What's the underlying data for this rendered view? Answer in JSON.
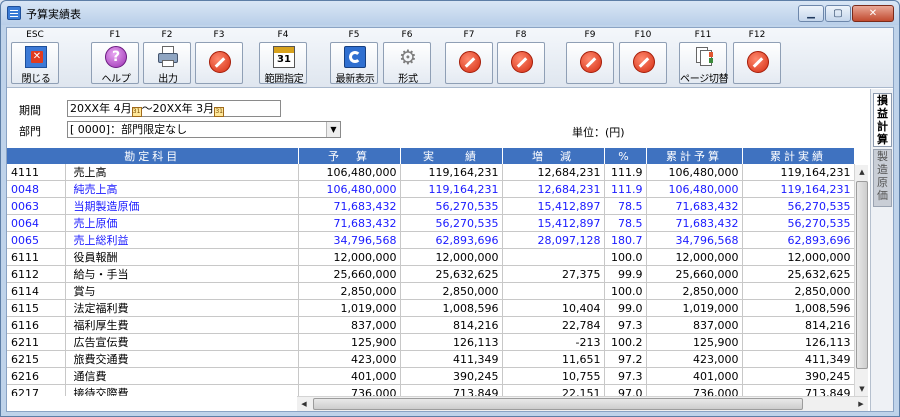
{
  "window": {
    "title": "予算実績表"
  },
  "toolbar": {
    "keys": [
      {
        "key": "ESC",
        "label": "閉じる",
        "icon": "close-window-icon"
      },
      {
        "key": "F1",
        "label": "ヘルプ",
        "icon": "help-icon"
      },
      {
        "key": "F2",
        "label": "出力",
        "icon": "print-icon"
      },
      {
        "key": "F3",
        "label": "",
        "icon": "disabled-icon"
      },
      {
        "key": "F4",
        "label": "範囲指定",
        "icon": "calendar-icon"
      },
      {
        "key": "F5",
        "label": "最新表示",
        "icon": "refresh-icon"
      },
      {
        "key": "F6",
        "label": "形式",
        "icon": "gear-icon"
      },
      {
        "key": "F7",
        "label": "",
        "icon": "disabled-icon"
      },
      {
        "key": "F8",
        "label": "",
        "icon": "disabled-icon"
      },
      {
        "key": "F9",
        "label": "",
        "icon": "disabled-icon"
      },
      {
        "key": "F10",
        "label": "",
        "icon": "disabled-icon"
      },
      {
        "key": "F11",
        "label": "ページ切替",
        "icon": "page-switch-icon"
      },
      {
        "key": "F12",
        "label": "",
        "icon": "disabled-icon"
      }
    ]
  },
  "filter": {
    "period_label": "期間",
    "period_from": "20XX年 4月",
    "period_sep": "～",
    "period_to": "20XX年 3月",
    "dept_label": "部門",
    "dept_value": "[ 0000]：部門限定なし",
    "unit_label": "単位：(円)"
  },
  "side_tabs": {
    "active": "損益計算",
    "inactive": "製造原価"
  },
  "table": {
    "columns": [
      "勘定科目",
      "予　算",
      "実　　績",
      "増　減",
      "%",
      "累計予算",
      "累計実績"
    ],
    "rows": [
      {
        "code": "4111",
        "name": "売上高",
        "budget": "106,480,000",
        "actual": "119,164,231",
        "diff": "12,684,231",
        "pct": "111.9",
        "cum_budget": "106,480,000",
        "cum_actual": "119,164,231",
        "blue": false
      },
      {
        "code": "0048",
        "name": "純売上高",
        "budget": "106,480,000",
        "actual": "119,164,231",
        "diff": "12,684,231",
        "pct": "111.9",
        "cum_budget": "106,480,000",
        "cum_actual": "119,164,231",
        "blue": true
      },
      {
        "code": "0063",
        "name": "当期製造原価",
        "budget": "71,683,432",
        "actual": "56,270,535",
        "diff": "15,412,897",
        "pct": "78.5",
        "cum_budget": "71,683,432",
        "cum_actual": "56,270,535",
        "blue": true
      },
      {
        "code": "0064",
        "name": "売上原価",
        "budget": "71,683,432",
        "actual": "56,270,535",
        "diff": "15,412,897",
        "pct": "78.5",
        "cum_budget": "71,683,432",
        "cum_actual": "56,270,535",
        "blue": true
      },
      {
        "code": "0065",
        "name": "売上総利益",
        "budget": "34,796,568",
        "actual": "62,893,696",
        "diff": "28,097,128",
        "pct": "180.7",
        "cum_budget": "34,796,568",
        "cum_actual": "62,893,696",
        "blue": true
      },
      {
        "code": "6111",
        "name": "役員報酬",
        "budget": "12,000,000",
        "actual": "12,000,000",
        "diff": "",
        "pct": "100.0",
        "cum_budget": "12,000,000",
        "cum_actual": "12,000,000",
        "blue": false
      },
      {
        "code": "6112",
        "name": "給与・手当",
        "budget": "25,660,000",
        "actual": "25,632,625",
        "diff": "27,375",
        "pct": "99.9",
        "cum_budget": "25,660,000",
        "cum_actual": "25,632,625",
        "blue": false
      },
      {
        "code": "6114",
        "name": "賞与",
        "budget": "2,850,000",
        "actual": "2,850,000",
        "diff": "",
        "pct": "100.0",
        "cum_budget": "2,850,000",
        "cum_actual": "2,850,000",
        "blue": false
      },
      {
        "code": "6115",
        "name": "法定福利費",
        "budget": "1,019,000",
        "actual": "1,008,596",
        "diff": "10,404",
        "pct": "99.0",
        "cum_budget": "1,019,000",
        "cum_actual": "1,008,596",
        "blue": false
      },
      {
        "code": "6116",
        "name": "福利厚生費",
        "budget": "837,000",
        "actual": "814,216",
        "diff": "22,784",
        "pct": "97.3",
        "cum_budget": "837,000",
        "cum_actual": "814,216",
        "blue": false
      },
      {
        "code": "6211",
        "name": "広告宣伝費",
        "budget": "125,900",
        "actual": "126,113",
        "diff": "-213",
        "pct": "100.2",
        "cum_budget": "125,900",
        "cum_actual": "126,113",
        "blue": false
      },
      {
        "code": "6215",
        "name": "旅費交通費",
        "budget": "423,000",
        "actual": "411,349",
        "diff": "11,651",
        "pct": "97.2",
        "cum_budget": "423,000",
        "cum_actual": "411,349",
        "blue": false
      },
      {
        "code": "6216",
        "name": "通信費",
        "budget": "401,000",
        "actual": "390,245",
        "diff": "10,755",
        "pct": "97.3",
        "cum_budget": "401,000",
        "cum_actual": "390,245",
        "blue": false
      },
      {
        "code": "6217",
        "name": "接待交際費",
        "budget": "736,000",
        "actual": "713,849",
        "diff": "22,151",
        "pct": "97.0",
        "cum_budget": "736,000",
        "cum_actual": "713,849",
        "blue": false
      }
    ]
  }
}
